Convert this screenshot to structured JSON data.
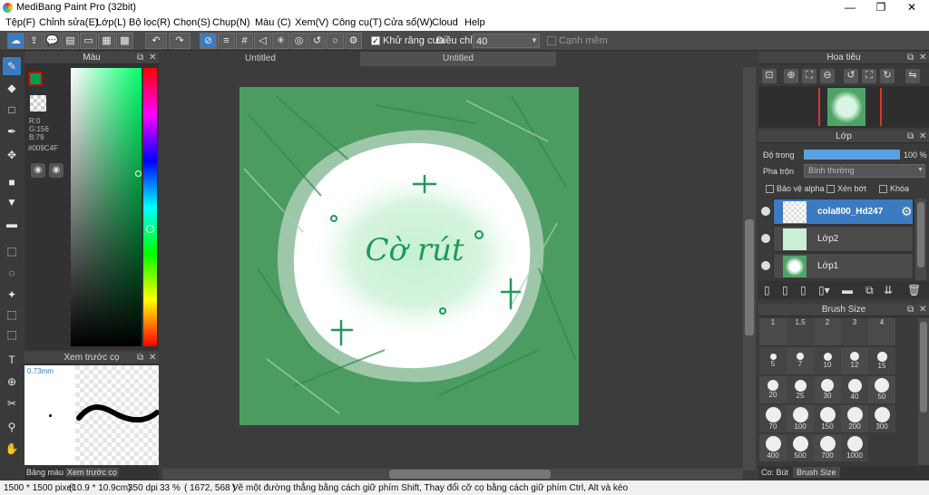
{
  "window": {
    "title": "MediBang Paint Pro (32bit)",
    "minimize": "—",
    "restore": "❐",
    "close": "✕"
  },
  "menu": [
    "Tệp(F)",
    "Chỉnh sửa(E)",
    "Lớp(L)",
    "Bộ lọc(R)",
    "Chọn(S)",
    "Chụp(N)",
    "Màu (C)",
    "Xem(V)",
    "Công cụ(T)",
    "Cửa sổ(W)",
    "Cloud",
    "Help"
  ],
  "toolbar": {
    "antialias_label": "Khử răng cưa",
    "adjust_label": "Điều chỉnh",
    "adjust_value": "40",
    "edge_label": "Cạnh mềm"
  },
  "color_panel": {
    "title": "Màu",
    "r": "R:0",
    "g": "G:156",
    "b": "B:79",
    "hex": "#009C4F",
    "primary": "#009C4F"
  },
  "brush_preview": {
    "title": "Xem trước cọ",
    "size": "0.73mm",
    "tab1": "Bảng màu",
    "tab2": "Xem trước cọ"
  },
  "tabs": [
    "Untitled",
    "Untitled"
  ],
  "canvas": {
    "text": "Cờ rút"
  },
  "navigator": {
    "title": "Hoa tiêu"
  },
  "layers": {
    "title": "Lớp",
    "opacity_label": "Độ trong",
    "opacity_value": "100 %",
    "opacity": 1.0,
    "blend_label": "Pha trộn",
    "blend_value": "Bình thường",
    "protect_alpha": "Bảo vệ alpha",
    "clipping": "Xén bớt",
    "lock": "Khóa",
    "items": [
      {
        "name": "cola800_Hd247"
      },
      {
        "name": "Lớp2"
      },
      {
        "name": "Lớp1"
      }
    ]
  },
  "brush_size": {
    "title": "Brush Size",
    "sizes": [
      "1",
      "1.5",
      "2",
      "3",
      "4",
      "5",
      "7",
      "10",
      "12",
      "15",
      "20",
      "25",
      "30",
      "40",
      "50",
      "70",
      "100",
      "150",
      "200",
      "300",
      "400",
      "500",
      "700",
      "1000"
    ],
    "tab1": "Co: Bút",
    "tab2": "Brush Size"
  },
  "status": {
    "dims": "1500 * 1500 pixel",
    "cm": "(10.9 * 10.9cm)",
    "dpi": "350 dpi",
    "zoom": "33 %",
    "coords": "( 1672, 568 )",
    "hint": "Vẽ một đường thẳng bằng cách giữ phím Shift, Thay đổi cỡ cọ bằng cách giữ phím Ctrl, Alt và kéo"
  }
}
